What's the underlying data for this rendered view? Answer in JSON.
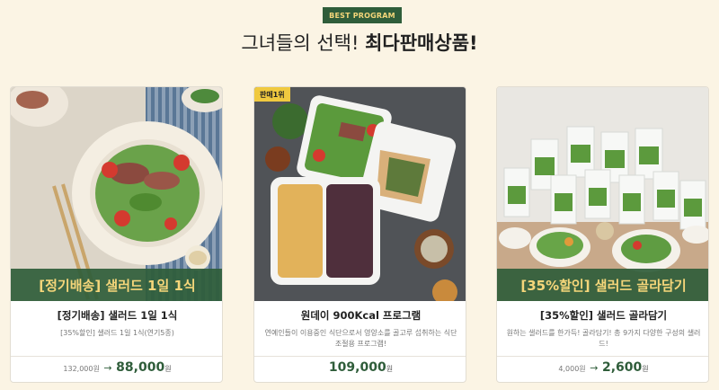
{
  "header": {
    "badge": "BEST PROGRAM",
    "headline_light": "그녀들의 선택!",
    "headline_bold": "최다판매상품!"
  },
  "cards": [
    {
      "banner": "[정기배송] 샐러드 1일 1식",
      "title": "[정기배송] 샐러드 1일 1식",
      "desc": "[35%할인] 샐러드 1일 1식(연기5종)",
      "old_price": "132,000원",
      "arrow": "→",
      "new_price": "88,000",
      "won": "원"
    },
    {
      "rank": "판매1위",
      "title": "원데이 900Kcal 프로그램",
      "desc": "연예인들이 이용중인 식단으로서 영양소를 골고루 섭취하는 식단조절용 프로그램!",
      "new_price": "109,000",
      "won": "원"
    },
    {
      "banner": "[35%할인] 샐러드 골라담기",
      "title": "[35%할인] 샐러드 골라담기",
      "desc": "원하는 샐러드를 한가득! 골라담기! 총 9가지 다양한 구성의 샐러드!",
      "old_price": "4,000원",
      "arrow": "→",
      "new_price": "2,600",
      "won": "원"
    }
  ]
}
